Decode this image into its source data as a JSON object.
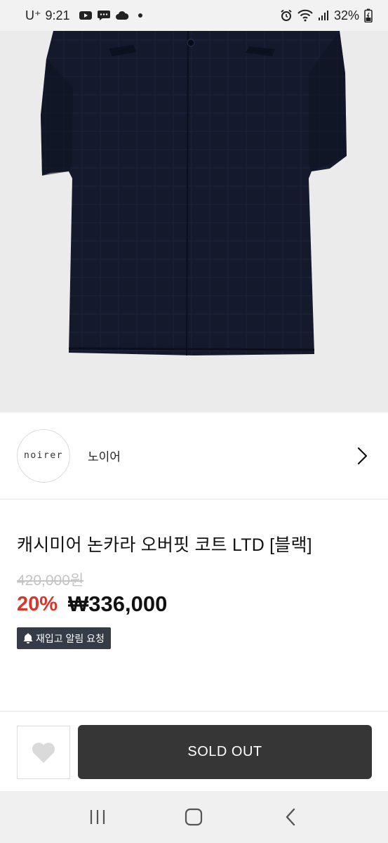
{
  "status_bar": {
    "carrier": "U⁺",
    "time": "9:21",
    "battery": "32%",
    "icons": [
      "youtube-icon",
      "chat-icon",
      "cloud-icon",
      "dot-icon",
      "alarm-icon",
      "wifi-icon",
      "signal-icon",
      "battery-icon"
    ]
  },
  "product_image": {
    "subject": "coat-image"
  },
  "brand": {
    "logo_text": "noirer",
    "name": "노이어"
  },
  "product": {
    "title": "캐시미어 논카라 오버핏 코트 LTD [블랙]",
    "original_price": "420,000원",
    "discount": "20%",
    "sale_price": "₩336,000",
    "restock_label": "재입고 알림 요청"
  },
  "actions": {
    "soldout_label": "SOLD OUT"
  },
  "colors": {
    "discount": "#d9362b",
    "restock_bg": "#353c47",
    "soldout_bg": "#363636",
    "coat": "#141a2c"
  }
}
